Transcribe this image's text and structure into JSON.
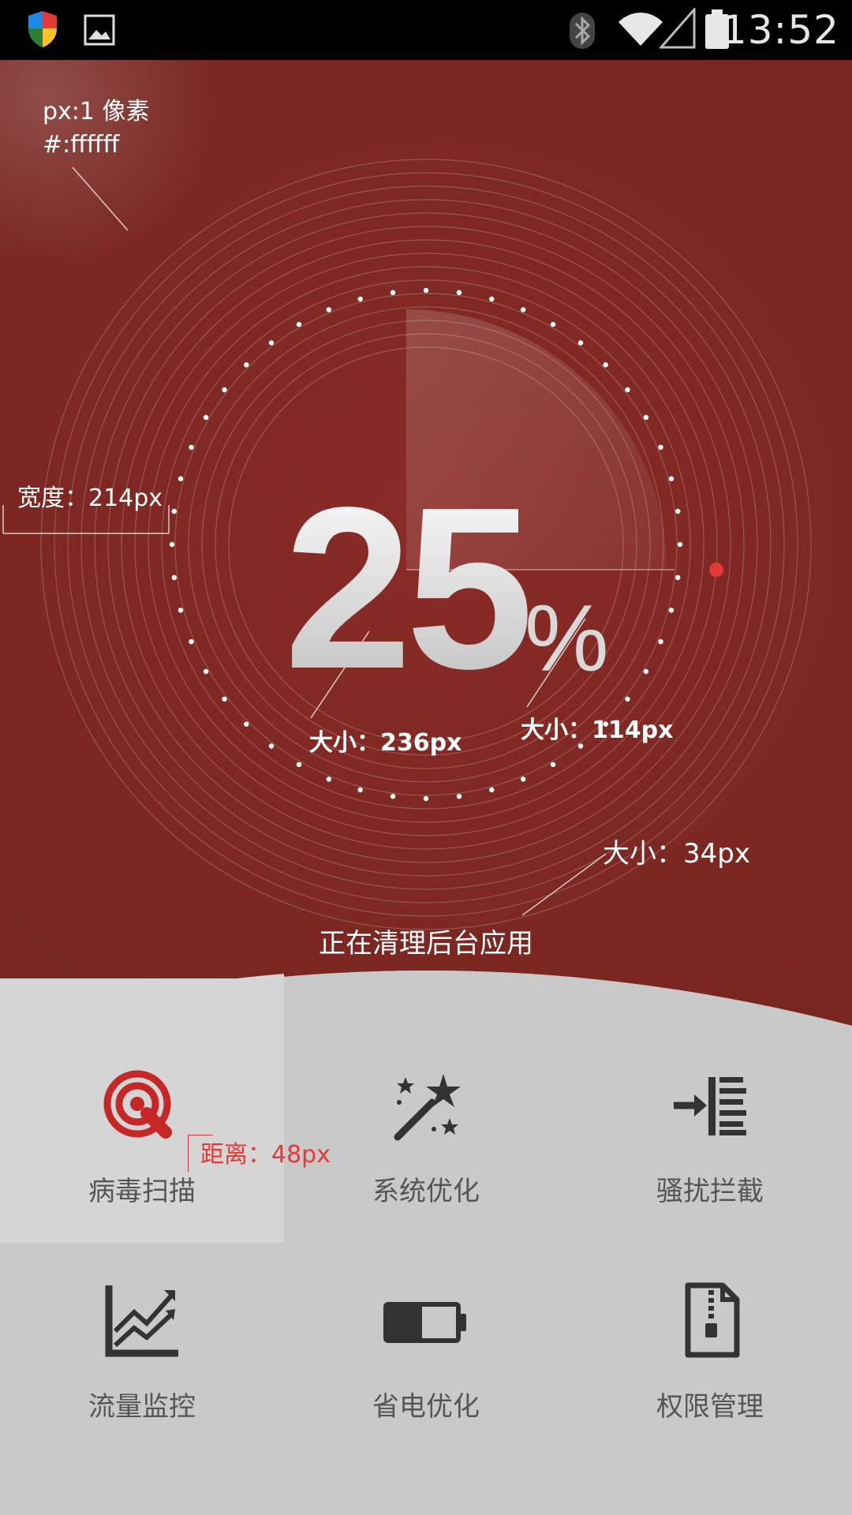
{
  "statusbar": {
    "time": "13:52",
    "icons": [
      "shield-icon",
      "image-icon",
      "bluetooth-icon",
      "wifi-icon",
      "signal-icon",
      "battery-icon"
    ]
  },
  "colors": {
    "accent": "#7e2823",
    "dot_red": "#e53935",
    "tile_bg": "#c9c9c9",
    "tile_selected_bg": "#d6d5d5",
    "icon_red": "#c62828",
    "icon_dark": "#333333"
  },
  "progress": {
    "number": "25",
    "percent_sign": "%",
    "value_percent": 25
  },
  "annotations": {
    "px_spec": "px:1 像素",
    "color_spec": "#:ffffff",
    "width_spec": "宽度：214px",
    "number_size": "大小：236px",
    "percent_size": "大小：114px",
    "status_size": "大小：34px",
    "distance": "距离：48px"
  },
  "status_text": "正在清理后台应用",
  "features": [
    {
      "label": "病毒扫描",
      "icon": "virus-scan-icon"
    },
    {
      "label": "系统优化",
      "icon": "magic-wand-icon"
    },
    {
      "label": "骚扰拦截",
      "icon": "block-arrow-icon"
    },
    {
      "label": "流量监控",
      "icon": "line-chart-icon"
    },
    {
      "label": "省电优化",
      "icon": "battery-saver-icon"
    },
    {
      "label": "权限管理",
      "icon": "permission-file-icon"
    }
  ]
}
